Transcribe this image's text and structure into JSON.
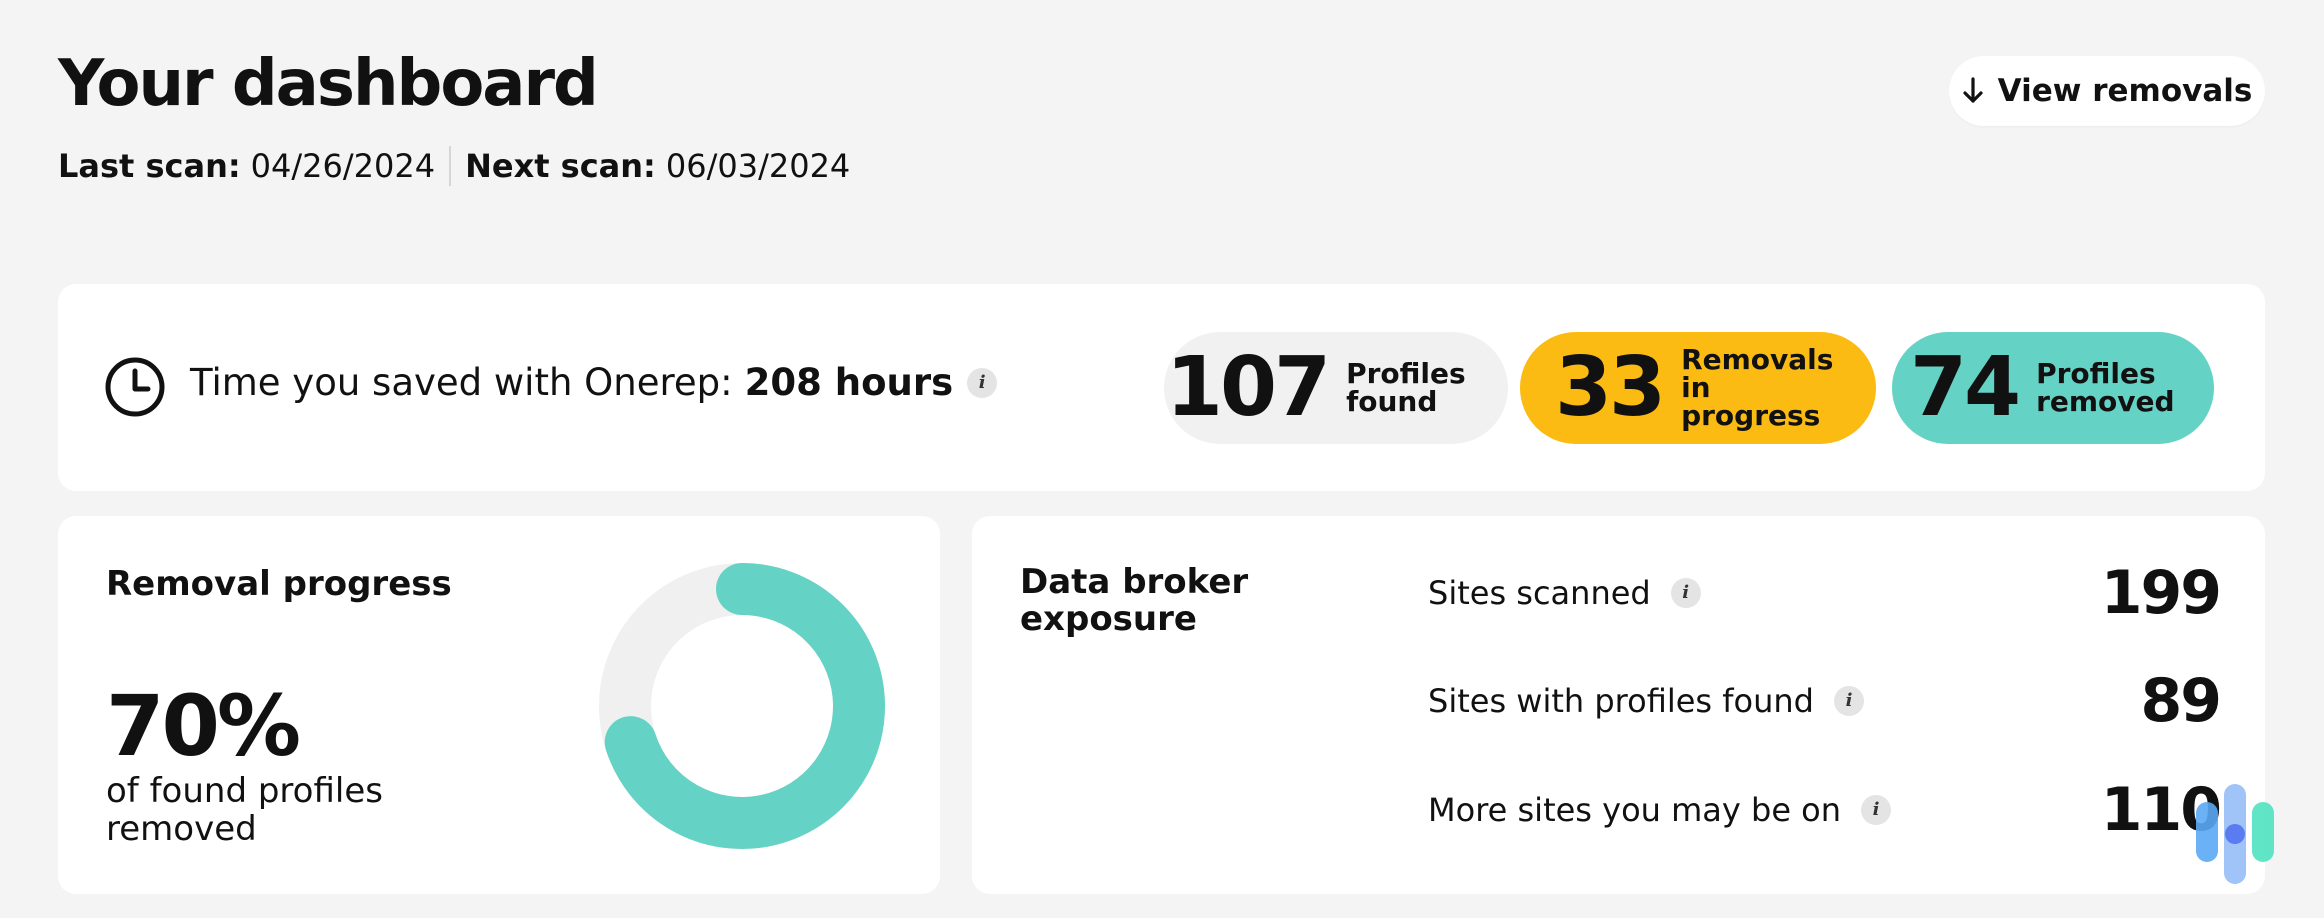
{
  "header": {
    "title": "Your dashboard",
    "last_scan_label": "Last scan:",
    "last_scan_value": "04/26/2024",
    "next_scan_label": "Next scan:",
    "next_scan_value": "06/03/2024",
    "view_removals_label": "View removals",
    "view_removals_icon": "arrow-down-icon"
  },
  "summary": {
    "clock_icon": "clock-icon",
    "saved_text": "Time you saved with Onerep:",
    "saved_hours": "208 hours",
    "pills": [
      {
        "value": "107",
        "label": "Profiles found",
        "color": "#f1f1f1"
      },
      {
        "value": "33",
        "label": "Removals in progress",
        "color": "#fbbb12"
      },
      {
        "value": "74",
        "label": "Profiles removed",
        "color": "#64d2c4"
      }
    ]
  },
  "removal_progress": {
    "title": "Removal progress",
    "percent_text": "70%",
    "percent_value": 0.7,
    "subtitle": "of found profiles removed",
    "ring_color": "#64d2c4",
    "track_color": "#f0f0f0"
  },
  "exposure": {
    "title": "Data broker exposure",
    "rows": [
      {
        "label": "Sites scanned",
        "value": "199"
      },
      {
        "label": "Sites with profiles found",
        "value": "89"
      },
      {
        "label": "More sites you may be on",
        "value": "110"
      }
    ]
  },
  "colors": {
    "background": "#f4f4f4",
    "card": "#ffffff",
    "accent_teal": "#64d2c4",
    "accent_yellow": "#fbbb12"
  }
}
